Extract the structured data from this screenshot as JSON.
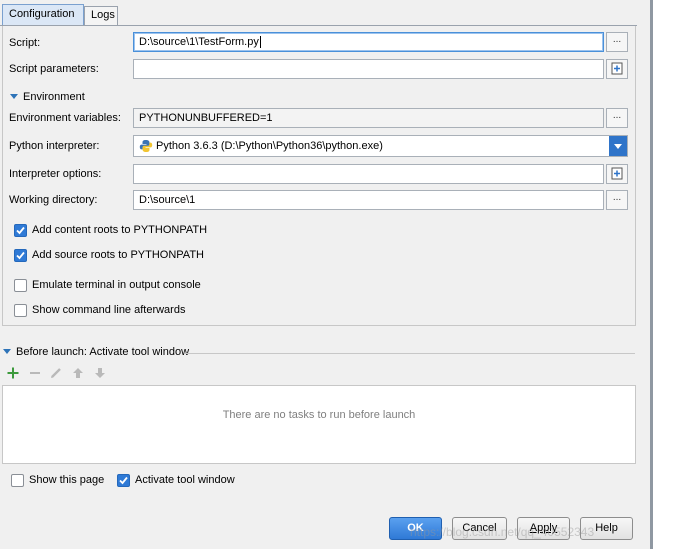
{
  "tabs": [
    {
      "label": "Configuration",
      "active": true
    },
    {
      "label": "Logs",
      "active": false
    }
  ],
  "fields": {
    "script": {
      "label": "Script:",
      "value": "D:\\source\\1\\TestForm.py"
    },
    "script_parameters": {
      "label": "Script parameters:",
      "value": ""
    },
    "environment_section": "Environment",
    "environment_variables": {
      "label": "Environment variables:",
      "value": "PYTHONUNBUFFERED=1"
    },
    "python_interpreter": {
      "label": "Python interpreter:",
      "value": "Python 3.6.3 (D:\\Python\\Python36\\python.exe)"
    },
    "interpreter_options": {
      "label": "Interpreter options:",
      "value": ""
    },
    "working_directory": {
      "label": "Working directory:",
      "value": "D:\\source\\1"
    }
  },
  "dots_label": "...",
  "checkboxes": [
    {
      "label": "Add content roots to PYTHONPATH",
      "checked": true
    },
    {
      "label": "Add source roots to PYTHONPATH",
      "checked": true
    },
    {
      "label": "Emulate terminal in output console",
      "checked": false
    },
    {
      "label": "Show command line afterwards",
      "checked": false
    }
  ],
  "before_launch": {
    "title": "Before launch: Activate tool window",
    "empty_text": "There are no tasks to run before launch",
    "toolbar": [
      "add-icon",
      "remove-icon",
      "edit-icon",
      "move-up-icon",
      "move-down-icon"
    ]
  },
  "bottom_checks": [
    {
      "label": "Show this page",
      "checked": false
    },
    {
      "label": "Activate tool window",
      "checked": true
    }
  ],
  "buttons": {
    "ok": "OK",
    "cancel": "Cancel",
    "apply": "Apply",
    "help": "Help"
  },
  "watermark": "https://blog.csdn.net/qq_40552343",
  "colors": {
    "accent": "#2f74c9",
    "checkbox": "#2f7ad6",
    "add_icon": "#3c9a3c"
  }
}
